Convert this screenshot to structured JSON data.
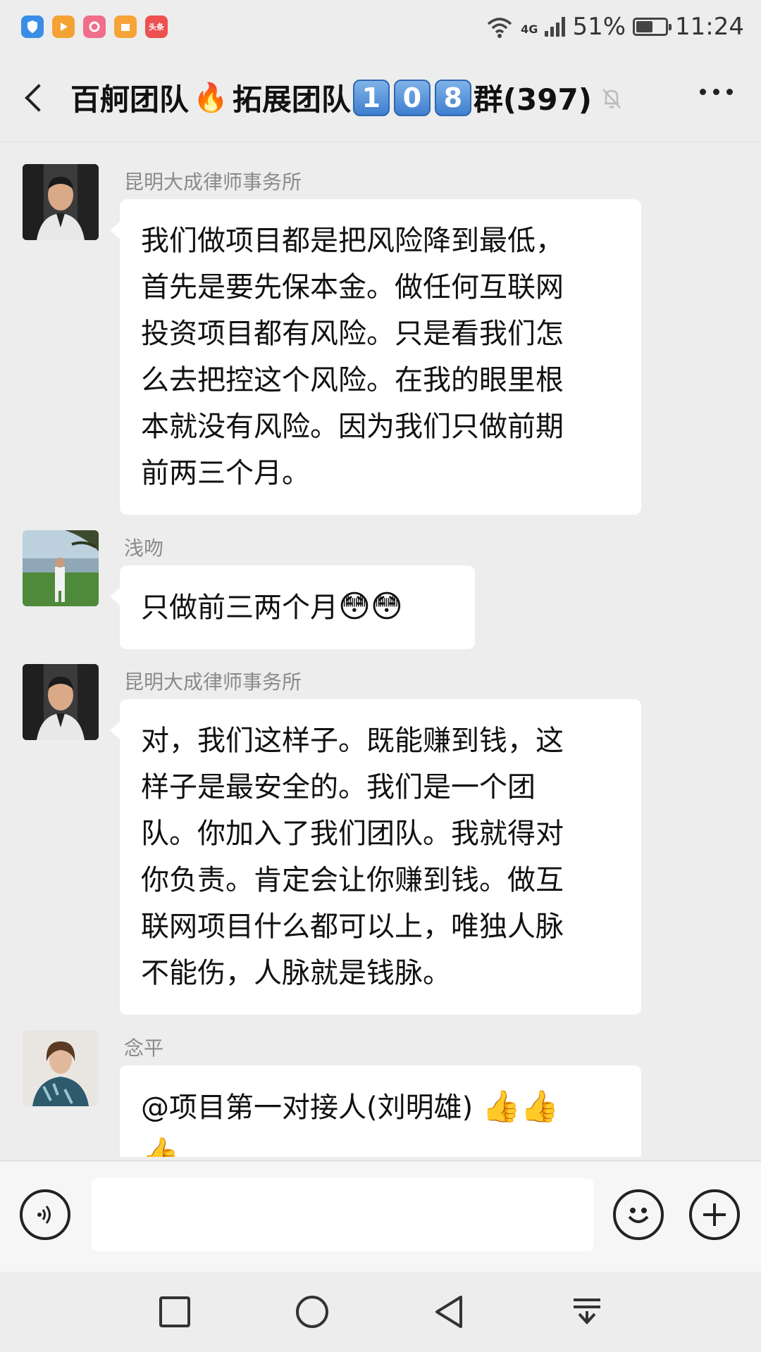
{
  "status_bar": {
    "apps": [
      {
        "icon": "shield-app-icon",
        "color": "#3a8ee6",
        "label": ""
      },
      {
        "icon": "video-app-icon",
        "color": "#f5a234",
        "label": ""
      },
      {
        "icon": "camera-app-icon",
        "color": "#f06e8a",
        "label": ""
      },
      {
        "icon": "box-app-icon",
        "color": "#f7a338",
        "label": ""
      },
      {
        "icon": "news-app-icon",
        "color": "#ee4f4f",
        "label": "头条"
      }
    ],
    "network": "4G",
    "battery": "51%",
    "time": "11:24"
  },
  "header": {
    "title_part1": "百舸团队",
    "title_part2": "拓展团队",
    "keycaps": [
      "1",
      "0",
      "8"
    ],
    "title_suffix": "群(397)"
  },
  "messages": [
    {
      "sender": "昆明大成律师事务所",
      "avatar": "man-in-car-avatar",
      "lines": [
        "我们做项目都是把风险降到最低，",
        "首先是要先保本金。做任何互联网",
        "投资项目都有风险。只是看我们怎",
        "么去把控这个风险。在我的眼里根",
        "本就没有风险。因为我们只做前期",
        "前两三个月。"
      ]
    },
    {
      "sender": "浅吻",
      "avatar": "person-by-lake-avatar",
      "text": "只做前三两个月",
      "emojis": "😳😳"
    },
    {
      "sender": "昆明大成律师事务所",
      "avatar": "man-in-car-avatar",
      "lines": [
        "对，我们这样子。既能赚到钱，这",
        "样子是最安全的。我们是一个团",
        "队。你加入了我们团队。我就得对",
        "你负责。肯定会让你赚到钱。做互",
        "联网项目什么都可以上，唯独人脉",
        "不能伤，人脉就是钱脉。"
      ]
    },
    {
      "sender": "念平",
      "avatar": "woman-avatar",
      "text": "@项目第一对接人(刘明雄) ",
      "emojis_line1": "👍👍",
      "emojis_line2": "👍"
    }
  ],
  "input": {
    "placeholder": ""
  }
}
